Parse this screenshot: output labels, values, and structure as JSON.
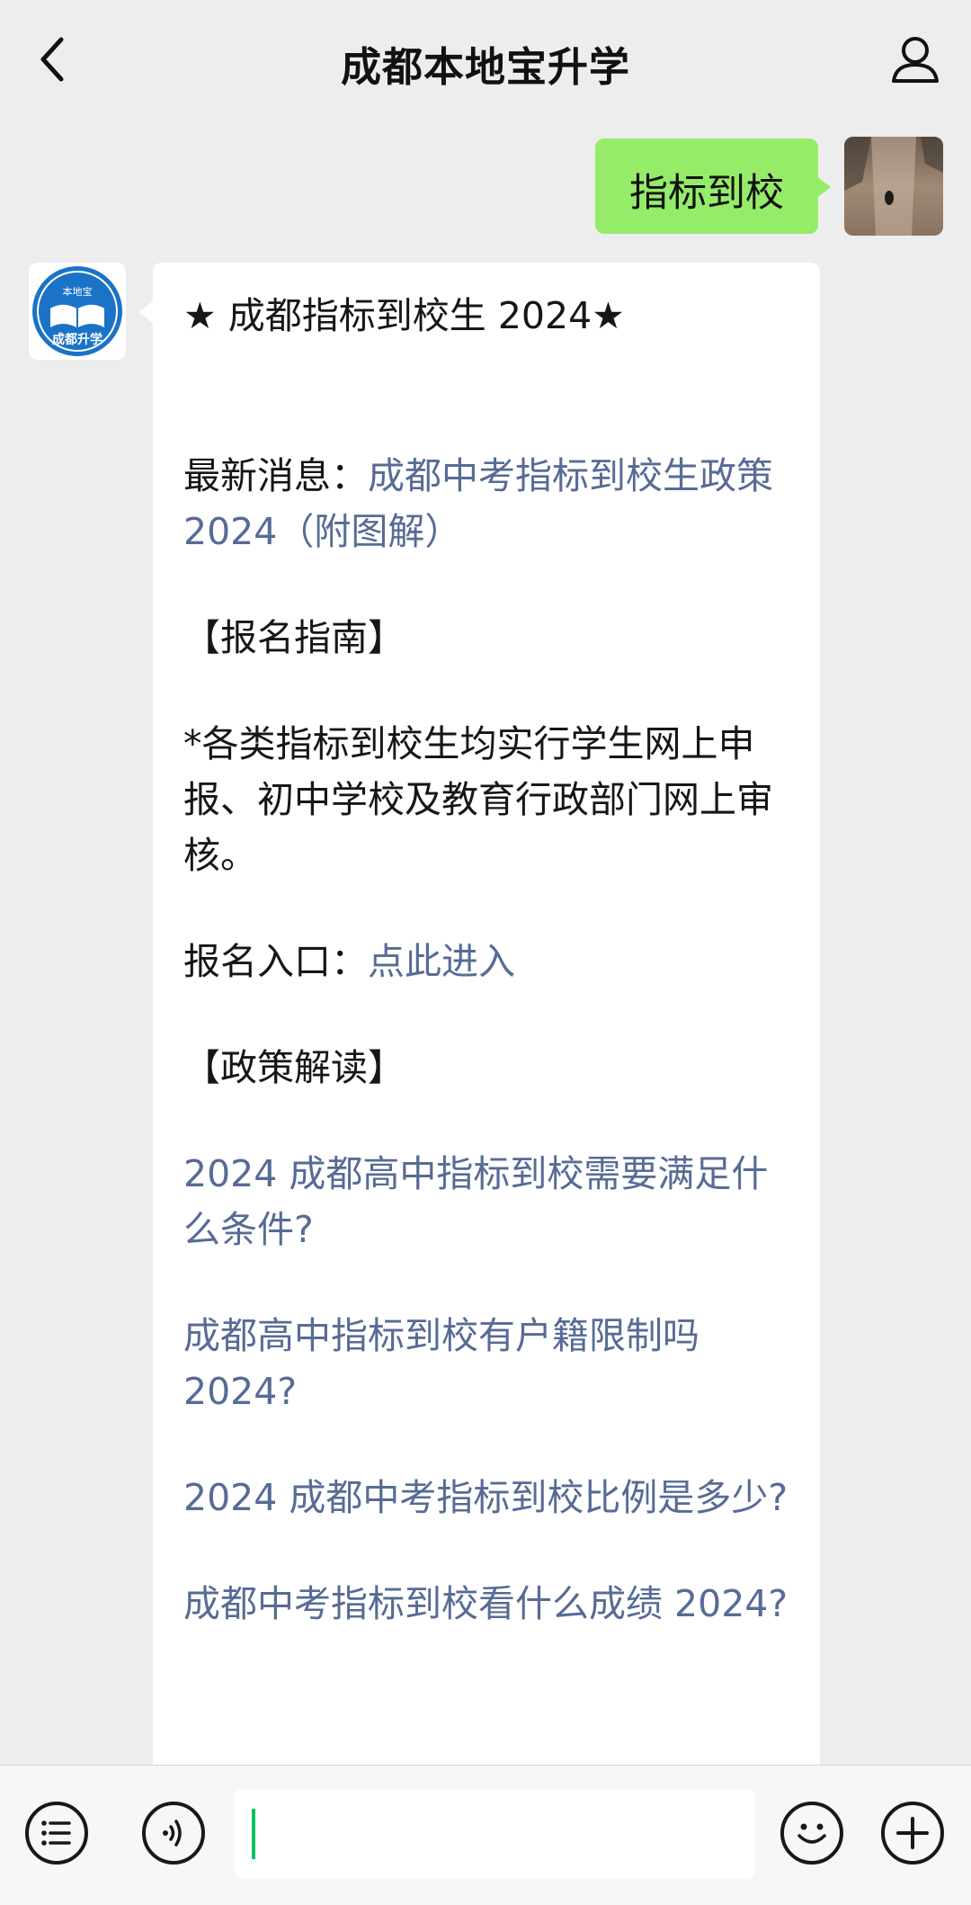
{
  "header": {
    "title": "成都本地宝升学"
  },
  "sent_message": {
    "text": "指标到校"
  },
  "bot_avatar": {
    "top_text": "本地宝",
    "bottom_text": "成都升学"
  },
  "received_message": {
    "heading": "★ 成都指标到校生 2024★",
    "latest_label": "最新消息：",
    "latest_link": "成都中考指标到校生政策 2024（附图解）",
    "section_signup": "【报名指南】",
    "signup_text": "*各类指标到校生均实行学生网上申报、初中学校及教育行政部门网上审核。",
    "entry_label": "报名入口：",
    "entry_link": "点此进入",
    "section_policy": "【政策解读】",
    "links": [
      "2024 成都高中指标到校需要满足什么条件?",
      "成都高中指标到校有户籍限制吗 2024?",
      "2024 成都中考指标到校比例是多少?",
      "成都中考指标到校看什么成绩 2024?"
    ]
  },
  "colors": {
    "background": "#ededed",
    "sent_bubble": "#95ec69",
    "link": "#576b95",
    "input_caret": "#07c160"
  },
  "icons": [
    "chevron-left-icon",
    "person-icon",
    "list-icon",
    "voice-icon",
    "emoji-icon",
    "plus-icon"
  ]
}
